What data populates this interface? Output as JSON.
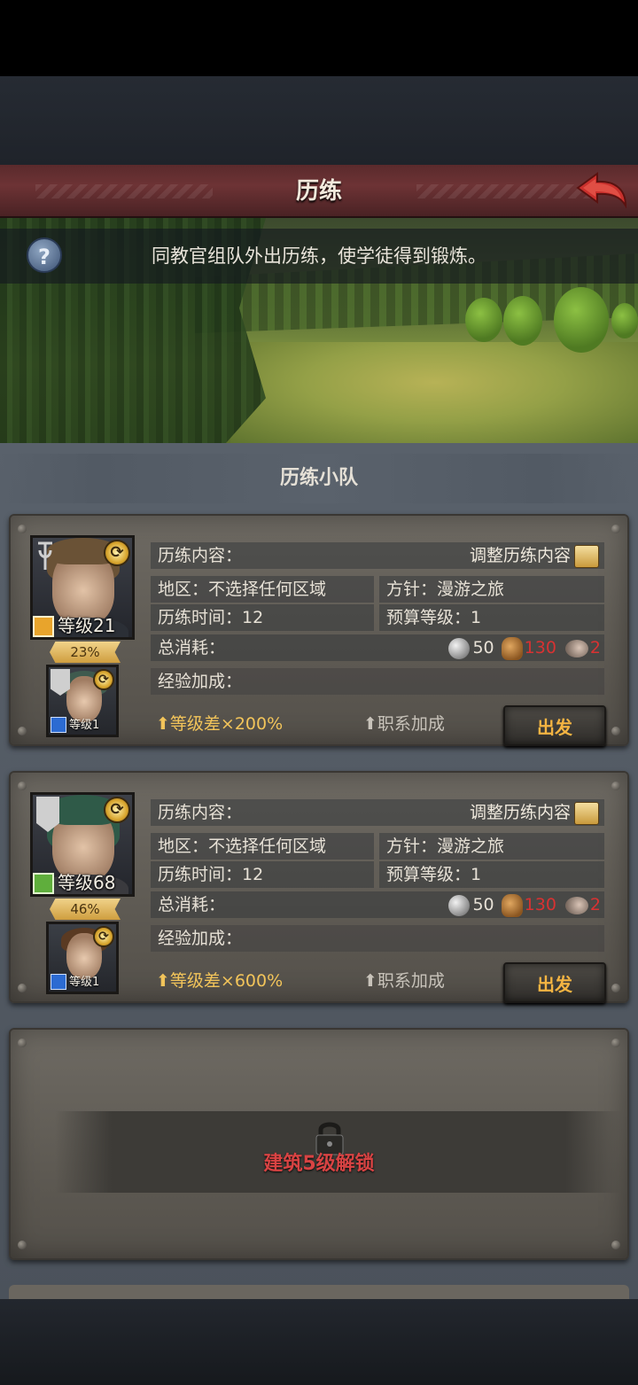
{
  "header": {
    "title": "历练"
  },
  "banner": {
    "description": "同教官组队外出历练，使学徒得到锻炼。",
    "help_symbol": "?"
  },
  "section": {
    "title": "历练小队"
  },
  "teams": [
    {
      "mentor": {
        "level_text": "等级21",
        "progress": "23%",
        "progress_value": 23
      },
      "apprentice": {
        "level_text": "等级1"
      },
      "content_label": "历练内容：",
      "adjust_label": "调整历练内容",
      "region_label": "地区：不选择任何区域",
      "policy_label": "方针：漫游之旅",
      "time_label": "历练时间：12",
      "budget_label": "预算等级：1",
      "cost_label": "总消耗：",
      "cost_silver": "50",
      "cost_food": "130",
      "cost_fish": "2",
      "exp_label": "经验加成：",
      "level_diff": "等级差×200%",
      "class_bonus": "职系加成",
      "go_label": "出发"
    },
    {
      "mentor": {
        "level_text": "等级68",
        "progress": "46%",
        "progress_value": 46
      },
      "apprentice": {
        "level_text": "等级1"
      },
      "content_label": "历练内容：",
      "adjust_label": "调整历练内容",
      "region_label": "地区：不选择任何区域",
      "policy_label": "方针：漫游之旅",
      "time_label": "历练时间：12",
      "budget_label": "预算等级：1",
      "cost_label": "总消耗：",
      "cost_silver": "50",
      "cost_food": "130",
      "cost_fish": "2",
      "exp_label": "经验加成：",
      "level_diff": "等级差×600%",
      "class_bonus": "职系加成",
      "go_label": "出发"
    }
  ],
  "locked_slot": {
    "text": "建筑5级解锁"
  },
  "colors": {
    "accent_gold": "#f2c45a",
    "cost_red": "#d83232",
    "title_bar": "#6d3335"
  },
  "icons": [
    "back-arrow-icon",
    "help-icon",
    "scroll-icon",
    "silver-coin-icon",
    "food-sack-icon",
    "fish-icon",
    "lock-icon",
    "swap-icon",
    "up-arrow-icon"
  ]
}
